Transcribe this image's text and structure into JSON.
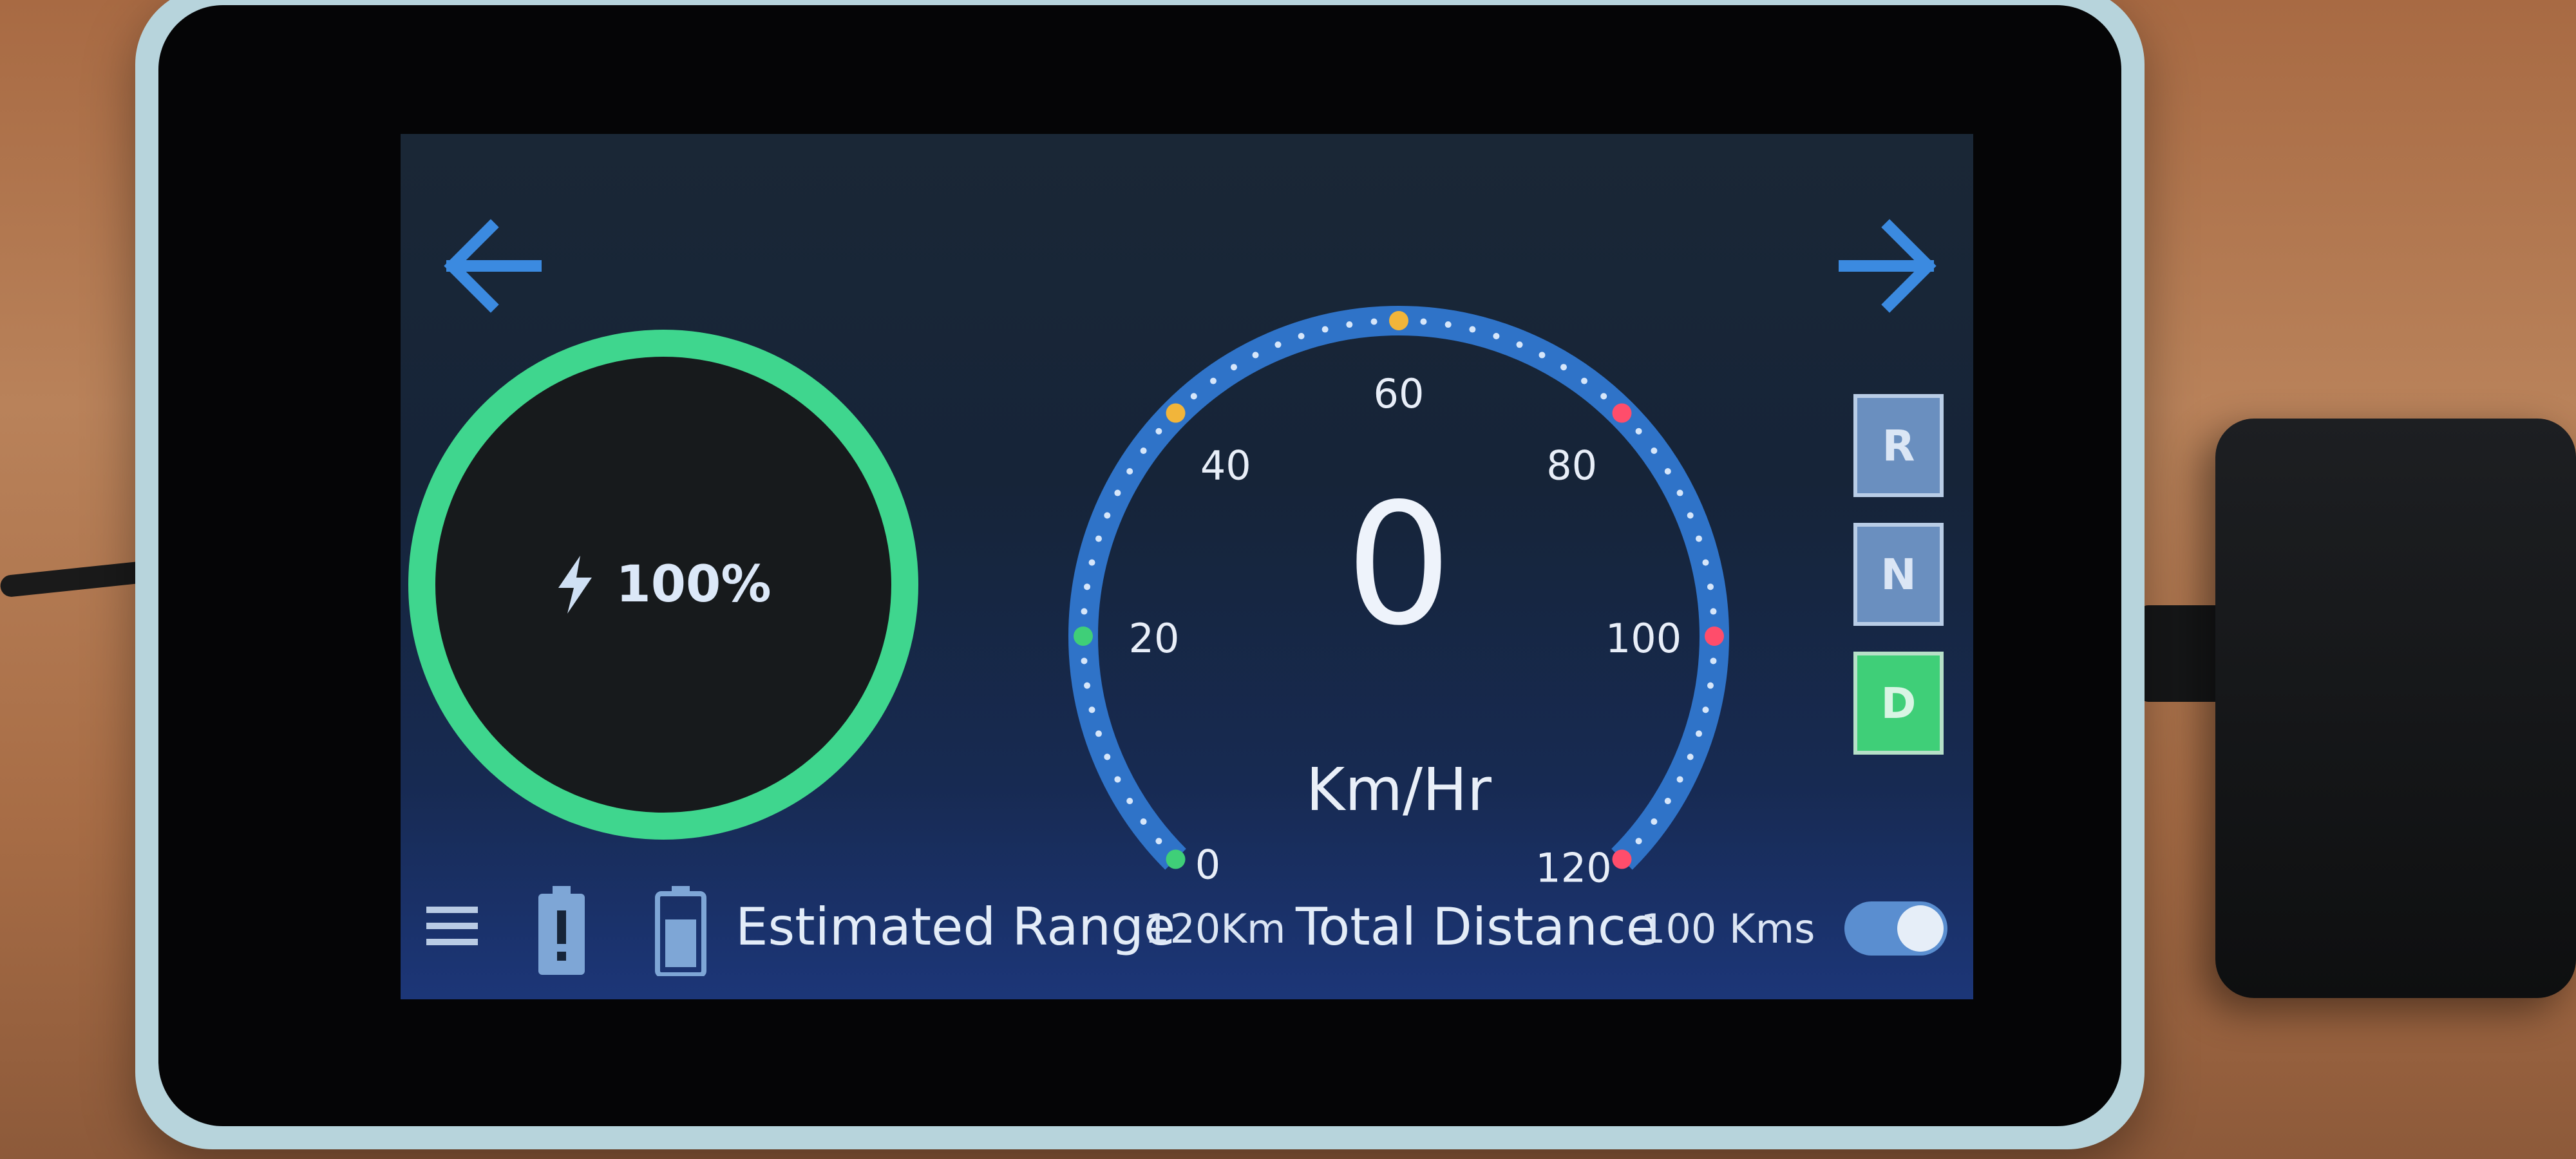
{
  "navigation": {
    "back_icon": "arrow-left-icon",
    "forward_icon": "arrow-right-icon"
  },
  "battery": {
    "charge_percent": 100,
    "label": "100%",
    "icon": "lightning-bolt-icon",
    "ring_color": "#3fd68e"
  },
  "speedometer": {
    "current_speed": 0,
    "speed_label": "0",
    "unit": "Km/Hr",
    "min": 0,
    "max": 120,
    "tick_labels": [
      "0",
      "20",
      "40",
      "60",
      "80",
      "100",
      "120"
    ],
    "marker_colors": {
      "0": "#3fcf78",
      "20": "#3fcf78",
      "40": "#f2b53a",
      "60": "#f2b53a",
      "80": "#ff4d6b",
      "100": "#ff4d6b",
      "120": "#ff4d6b"
    },
    "arc_color": "#2f73c8"
  },
  "gears": {
    "reverse": "R",
    "neutral": "N",
    "drive": "D",
    "selected": "D"
  },
  "status_bar": {
    "menu_icon": "hamburger-menu-icon",
    "battery_alert_icon": "battery-alert-icon",
    "battery_full_icon": "battery-full-icon",
    "estimated_range_label": "Estimated Range",
    "estimated_range_value": "120Km",
    "total_distance_label": "Total Distance",
    "total_distance_value": "100 Kms",
    "toggle_on": true
  }
}
